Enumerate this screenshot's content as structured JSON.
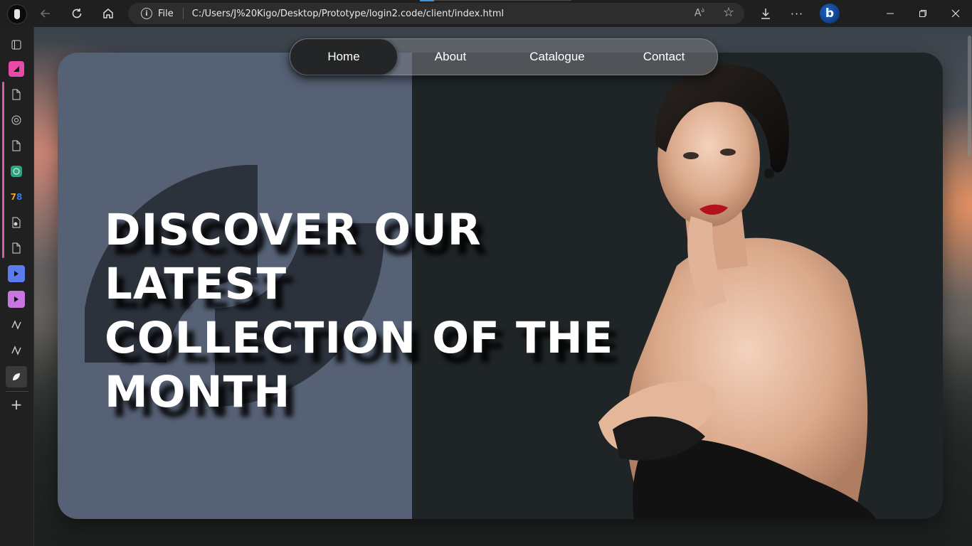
{
  "browser": {
    "address": {
      "protocol_label": "File",
      "url": "C:/Users/J%20Kigo/Desktop/Prototype/login2.code/client/index.html"
    },
    "toolbar_icons": [
      "back-icon",
      "refresh-icon",
      "home-icon",
      "read-aloud-icon",
      "favorite-star-icon",
      "downloads-icon",
      "more-icon",
      "bing-icon"
    ],
    "window_controls": [
      "minimize-icon",
      "restore-icon",
      "close-icon"
    ]
  },
  "sidebar": {
    "items": [
      "tab-actions-icon",
      "collection-pink-icon",
      "page-icon",
      "openai-icon",
      "page-icon",
      "chatgpt-icon",
      "app-icon",
      "page-settings-icon",
      "page-icon",
      "blue-arrow-icon",
      "purple-arrow-icon",
      "wave-icon",
      "wave-icon",
      "leaf-icon",
      "add-icon"
    ],
    "group_color": "#d35ba8"
  },
  "site": {
    "nav": {
      "items": [
        {
          "label": "Home",
          "active": true
        },
        {
          "label": "About",
          "active": false
        },
        {
          "label": "Catalogue",
          "active": false
        },
        {
          "label": "Contact",
          "active": false
        }
      ]
    },
    "hero": {
      "headline_line1": "DISCOVER OUR LATEST",
      "headline_line2": "COLLECTION OF THE",
      "headline_line3": "MONTH",
      "left_panel_color": "#566175",
      "right_panel_color": "#1f2527"
    }
  }
}
